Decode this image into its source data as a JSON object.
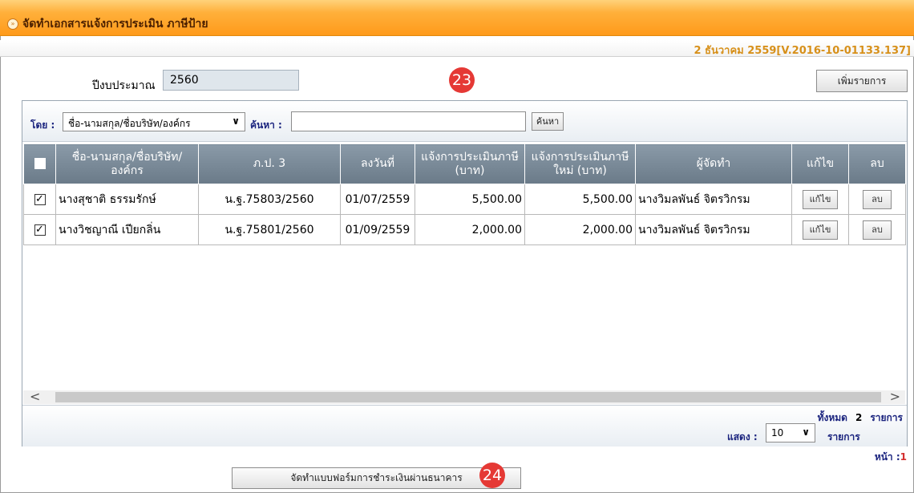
{
  "header": {
    "title": "จัดทำเอกสารแจ้งการประเมิน ภาษีป้าย",
    "version": "2 ธันวาคม 2559[V.2016-10-01133.137]"
  },
  "form": {
    "year_label": "ปีงบประมาณ",
    "year_value": "2560",
    "add_label": "เพิ่มรายการ"
  },
  "callouts": {
    "first": "23",
    "second": "24"
  },
  "search": {
    "by_label": "โดย :",
    "by_value": "ชื่อ-นามสกุล/ชื่อบริษัท/องค์กร",
    "find_label": "ค้นหา :",
    "find_value": "",
    "find_button": "ค้นหา"
  },
  "table": {
    "headers": [
      "ชื่อ-นามสกุล/ชื่อบริษัท/องค์กร",
      "ภ.ป. 3",
      "ลงวันที่",
      "แจ้งการประเมินภาษี (บาท)",
      "แจ้งการประเมินภาษีใหม่ (บาท)",
      "ผู้จัดทำ",
      "แก้ไข",
      "ลบ"
    ],
    "rows": [
      {
        "checked": "✓",
        "name": "นางสุชาติ ธรรมรักษ์",
        "doc": "น.ฐ.75803/2560",
        "date": "01/07/2559",
        "assess": "5,500.00",
        "assess_new": "5,500.00",
        "maker": "นางวิมลพันธ์ จิตรวิกรม",
        "edit": "แก้ไข",
        "del": "ลบ"
      },
      {
        "checked": "✓",
        "name": "นางวิชญาณี เปียกลิ่น",
        "doc": "น.ฐ.75801/2560",
        "date": "01/09/2559",
        "assess": "2,000.00",
        "assess_new": "2,000.00",
        "maker": "นางวิมลพันธ์ จิตรวิกรม",
        "edit": "แก้ไข",
        "del": "ลบ"
      }
    ]
  },
  "scroll": {
    "left": "<",
    "right": ">"
  },
  "footer": {
    "total_label": "ทั้งหมด",
    "total_count": "2",
    "items_label": "รายการ",
    "show_label": "แสดง :",
    "show_value": "10",
    "page_label": "หน้า :",
    "page_value": "1"
  },
  "actions": {
    "pay_form": "จัดทำแบบฟอร์มการชำระเงินผ่านธนาคาร"
  }
}
